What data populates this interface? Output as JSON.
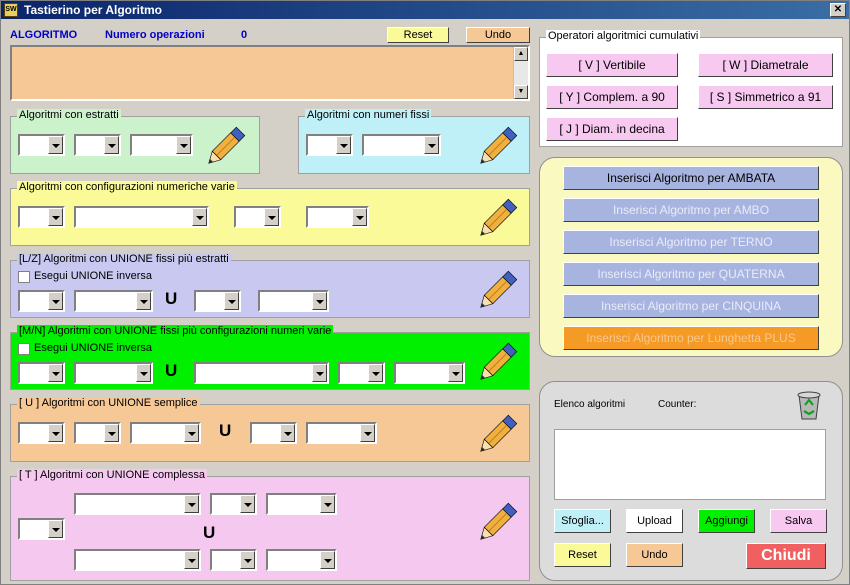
{
  "window": {
    "title": "Tastierino per Algoritmo",
    "close": "✕",
    "icon_text": "SW"
  },
  "header": {
    "algoritmo_label": "ALGORITMO",
    "num_ops_label": "Numero operazioni",
    "num_ops_value": "0",
    "reset": "Reset",
    "undo": "Undo"
  },
  "groups": {
    "estratti": "Algoritmi con estratti",
    "fissi": "Algoritmi con numeri fissi",
    "config": "Algoritmi con configurazioni numeriche varie",
    "lz": "[L/Z] Algoritmi con UNIONE fissi più estratti",
    "lz_check": "Esegui UNIONE inversa",
    "mn": "[M/N] Algoritmi con UNIONE fissi più configurazioni numeri varie",
    "mn_check": "Esegui UNIONE inversa",
    "u": "[ U ] Algoritmi con UNIONE semplice",
    "t": "[ T ] Algoritmi con UNIONE complessa",
    "union_symbol": "U"
  },
  "operators": {
    "title": "Operatori algoritmici cumulativi",
    "v": "[ V ] Vertibile",
    "w": "[ W ] Diametrale",
    "y": "[ Y ] Complem. a 90",
    "s": "[ S ] Simmetrico  a 91",
    "j": "[ J ] Diam. in decina"
  },
  "insert": {
    "ambata": "Inserisci Algoritmo per AMBATA",
    "ambo": "Inserisci Algoritmo per AMBO",
    "terno": "Inserisci Algoritmo per TERNO",
    "quaterna": "Inserisci Algoritmo per QUATERNA",
    "cinquina": "Inserisci Algoritmo per CINQUINA",
    "lunghetta": "Inserisci Algoritmo per Lunghetta PLUS"
  },
  "list": {
    "title": "Elenco algoritmi",
    "counter": "Counter:",
    "sfoglia": "Sfoglia...",
    "upload": "Upload",
    "aggiungi": "Aggiungi",
    "salva": "Salva",
    "reset": "Reset",
    "undo": "Undo",
    "chiudi": "Chiudi"
  },
  "colors": {
    "estratti": "#ccf2cc",
    "fissi": "#bff0f7",
    "config": "#fafa99",
    "lz": "#c8c8f0",
    "mn": "#00f000",
    "u": "#f5c896",
    "t": "#f5c8f0",
    "textarea": "#f5c896"
  }
}
